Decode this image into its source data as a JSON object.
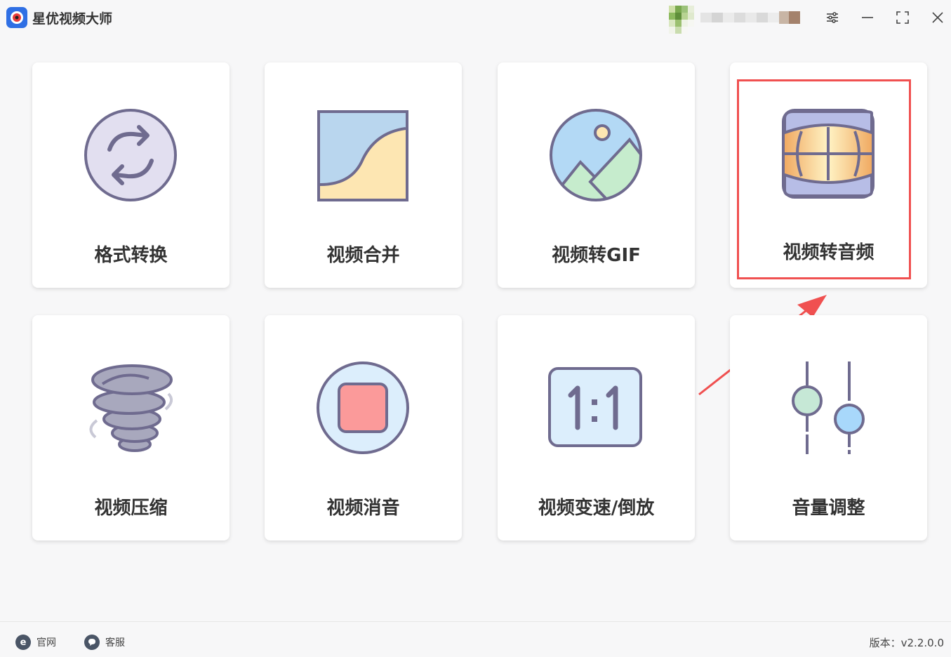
{
  "app": {
    "title": "星优视频大师"
  },
  "window_controls": [
    "settings-icon",
    "minimize-icon",
    "maximize-icon",
    "close-icon"
  ],
  "tools": [
    {
      "label": "格式转换",
      "icon": "convert-icon"
    },
    {
      "label": "视频合并",
      "icon": "merge-icon"
    },
    {
      "label": "视频转GIF",
      "icon": "gif-icon"
    },
    {
      "label": "视频转音频",
      "icon": "video-to-audio-icon"
    },
    {
      "label": "视频压缩",
      "icon": "compress-icon"
    },
    {
      "label": "视频消音",
      "icon": "mute-icon"
    },
    {
      "label": "视频变速/倒放",
      "icon": "speed-icon"
    },
    {
      "label": "音量调整",
      "icon": "volume-adjust-icon"
    }
  ],
  "footer": {
    "website": "官网",
    "support": "客服",
    "version": "版本：v2.2.0.0"
  },
  "colors": {
    "highlight": "#f05050",
    "accent": "#2f6fe4",
    "icon_stroke": "#6f6b8f"
  }
}
